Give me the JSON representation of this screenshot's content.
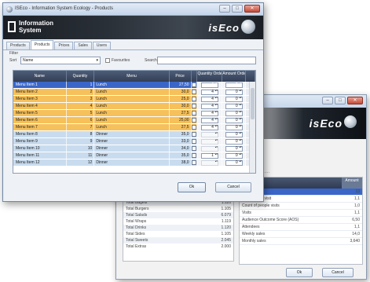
{
  "back_window": {
    "title": "",
    "controls": {
      "minimize": "–",
      "maximize": "□",
      "close": "✕"
    },
    "brand": "isEco",
    "body_label": "                         · <- ····",
    "check_label": "······· ····· ·····",
    "left_rows": [
      {
        "label": "Total Bagels",
        "value": "1.110"
      },
      {
        "label": "Total Burgers",
        "value": "1.105"
      },
      {
        "label": "Total Salads",
        "value": "6.079"
      },
      {
        "label": "Total Wraps",
        "value": "1.119"
      },
      {
        "label": "Total Drinks",
        "value": "1.120"
      },
      {
        "label": "Total Sides",
        "value": "1.105"
      },
      {
        "label": "Total Sweets",
        "value": "2.045"
      },
      {
        "label": "Total Extras",
        "value": "2.000"
      }
    ],
    "right_table": {
      "header_left": "Description",
      "header_right": "Amount",
      "rows": [
        {
          "label": "",
          "value": "13"
        },
        {
          "label": "Average per visit",
          "value": "1,1"
        },
        {
          "label": "Count of people visits",
          "value": "1,0"
        },
        {
          "label": "Visits",
          "value": "1,1"
        },
        {
          "label": "Audience Outcome Score (AOS)",
          "value": "6,50"
        },
        {
          "label": "Attendees",
          "value": "1,1"
        },
        {
          "label": "Weekly sales",
          "value": "14,0"
        },
        {
          "label": "Monthly sales",
          "value": "3,640"
        }
      ]
    },
    "ok_label": "Ok",
    "cancel_label": "Cancel"
  },
  "front_window": {
    "title": "ISEco - Information System Ecology - Products",
    "controls": {
      "minimize": "–",
      "maximize": "□",
      "close": "✕"
    },
    "banner": {
      "logo_line1": "Information",
      "logo_line2": "System",
      "brand": "isEco"
    },
    "tabs": [
      {
        "label": "Products",
        "active": false
      },
      {
        "label": "Products",
        "active": true
      },
      {
        "label": "Prices",
        "active": false
      },
      {
        "label": "Sales",
        "active": false
      },
      {
        "label": "Users",
        "active": false
      }
    ],
    "filter": {
      "group_label": "Filter",
      "sort_label": "Sort",
      "sort_value": "Name",
      "check_label": "Favourites",
      "search_label": "Search",
      "search_value": ""
    },
    "grid": {
      "headers": [
        "Name",
        "Quantity",
        "Menu",
        "Price",
        "",
        "Quantity Ordered",
        "Amount Ordered",
        ""
      ],
      "rows": [
        {
          "color": "sel",
          "name": "Menu Item 1",
          "qty": "1",
          "menu": "Lunch",
          "price": "27,50",
          "order_qty": "4",
          "order_amt": "0"
        },
        {
          "color": "orange",
          "name": "Menu Item 2",
          "qty": "2",
          "menu": "Lunch",
          "price": "30,0",
          "order_qty": "4",
          "order_amt": "0"
        },
        {
          "color": "orange",
          "name": "Menu Item 3",
          "qty": "3",
          "menu": "Lunch",
          "price": "25,0",
          "order_qty": "4",
          "order_amt": "0"
        },
        {
          "color": "orange",
          "name": "Menu Item 4",
          "qty": "4",
          "menu": "Lunch",
          "price": "30,0",
          "order_qty": "4",
          "order_amt": "0"
        },
        {
          "color": "orange",
          "name": "Menu Item 5",
          "qty": "5",
          "menu": "Lunch",
          "price": "27,5",
          "order_qty": "4",
          "order_amt": "0"
        },
        {
          "color": "orange",
          "name": "Menu Item 6",
          "qty": "6",
          "menu": "Lunch",
          "price": "25,00",
          "order_qty": "4",
          "order_amt": "0"
        },
        {
          "color": "orange",
          "name": "Menu Item 7",
          "qty": "7",
          "menu": "Lunch",
          "price": "27,5",
          "order_qty": "4",
          "order_amt": "0"
        },
        {
          "color": "blue",
          "name": "Menu Item 8",
          "qty": "8",
          "menu": "Dinner",
          "price": "35,0",
          "order_qty": "",
          "order_amt": "0"
        },
        {
          "color": "blue",
          "name": "Menu Item 9",
          "qty": "9",
          "menu": "Dinner",
          "price": "33,0",
          "order_qty": "",
          "order_amt": "0"
        },
        {
          "color": "blue",
          "name": "Menu Item 10",
          "qty": "10",
          "menu": "Dinner",
          "price": "34,0",
          "order_qty": "",
          "order_amt": "0"
        },
        {
          "color": "blue",
          "name": "Menu Item 11",
          "qty": "11",
          "menu": "Dinner",
          "price": "35,0",
          "order_qty": "1",
          "order_amt": "0"
        },
        {
          "color": "blue",
          "name": "Menu Item 12",
          "qty": "12",
          "menu": "Dinner",
          "price": "38,0",
          "order_qty": "",
          "order_amt": "0"
        }
      ]
    },
    "ok_label": "Ok",
    "cancel_label": "Cancel"
  }
}
